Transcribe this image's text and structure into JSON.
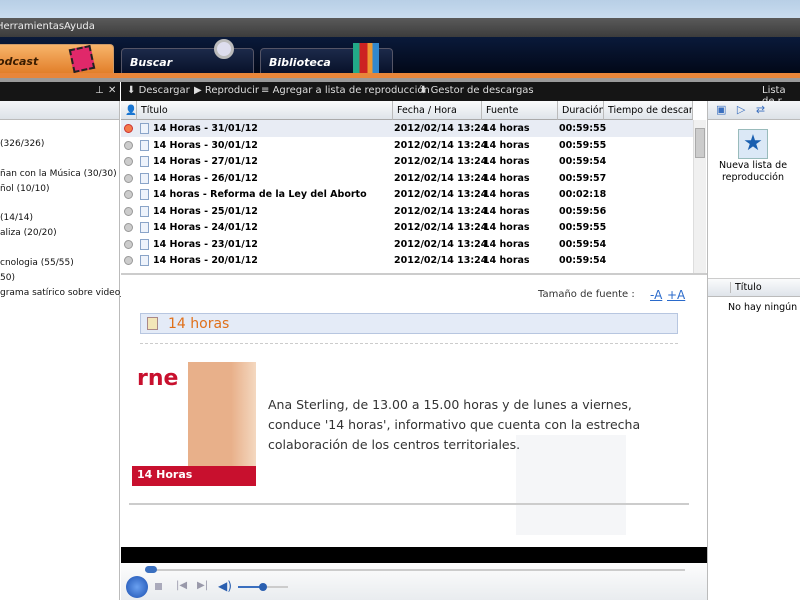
{
  "menu": {
    "tools": "Herramientas",
    "help": "Ayuda"
  },
  "tabs": {
    "podcast": "Podcast",
    "search": "Buscar",
    "library": "Biblioteca"
  },
  "toolbar": {
    "download": "Descargar",
    "play": "Reproducir",
    "add_playlist": "Agregar a lista de reproducción",
    "download_manager": "Gestor de descargas"
  },
  "tree": [
    "(326/326)",
    "ñan con la Música (30/30)",
    "ñol (10/10)",
    "(14/14)",
    "aliza (20/20)",
    "cnologia (55/55)",
    "50)",
    "grama satírico sobre videoju"
  ],
  "columns": {
    "title": "Título",
    "date": "Fecha / Hora",
    "source": "Fuente",
    "duration": "Duración",
    "download_time": "Tiempo de descar..."
  },
  "rows": [
    {
      "title": "14 Horas - 31/01/12",
      "date": "2012/02/14 13:24",
      "source": "14 horas",
      "duration": "00:59:55"
    },
    {
      "title": "14 Horas - 30/01/12",
      "date": "2012/02/14 13:24",
      "source": "14 horas",
      "duration": "00:59:55"
    },
    {
      "title": "14 Horas - 27/01/12",
      "date": "2012/02/14 13:24",
      "source": "14 horas",
      "duration": "00:59:54"
    },
    {
      "title": "14 Horas - 26/01/12",
      "date": "2012/02/14 13:24",
      "source": "14 horas",
      "duration": "00:59:57"
    },
    {
      "title": "14 horas - Reforma de la Ley del Aborto",
      "date": "2012/02/14 13:24",
      "source": "14 horas",
      "duration": "00:02:18"
    },
    {
      "title": "14 Horas - 25/01/12",
      "date": "2012/02/14 13:24",
      "source": "14 horas",
      "duration": "00:59:56"
    },
    {
      "title": "14 Horas - 24/01/12",
      "date": "2012/02/14 13:24",
      "source": "14 horas",
      "duration": "00:59:55"
    },
    {
      "title": "14 Horas - 23/01/12",
      "date": "2012/02/14 13:24",
      "source": "14 horas",
      "duration": "00:59:54"
    },
    {
      "title": "14 Horas - 20/01/12",
      "date": "2012/02/14 13:24",
      "source": "14 horas",
      "duration": "00:59:54"
    }
  ],
  "detail": {
    "font_size_label": "Tamaño de fuente :",
    "decrease": "-A",
    "increase": "+A",
    "title": "14 horas",
    "logo_text": "rne",
    "image_caption": "14 Horas",
    "description": "Ana Sterling, de 13.00 a 15.00 horas y de lunes a viernes, conduce '14 horas', informativo que cuenta con la estrecha colaboración de los centros territoriales."
  },
  "right": {
    "header": "Lista de r",
    "new_playlist": "Nueva lista de reproducción",
    "col_title": "Título",
    "empty": "No hay ningún e"
  },
  "player": {
    "progress": 0.0,
    "volume": 0.5
  }
}
